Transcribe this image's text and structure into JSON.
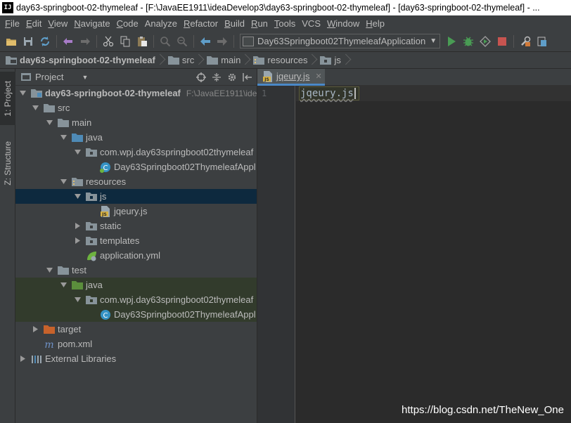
{
  "window": {
    "title": "day63-springboot-02-thymeleaf - [F:\\JavaEE1911\\ideaDevelop3\\day63-springboot-02-thymeleaf] - [day63-springboot-02-thymeleaf] - ...",
    "app_icon": "IJ"
  },
  "menu": {
    "items": [
      {
        "u": "F",
        "rest": "ile"
      },
      {
        "u": "E",
        "rest": "dit"
      },
      {
        "u": "V",
        "rest": "iew"
      },
      {
        "u": "N",
        "rest": "avigate"
      },
      {
        "u": "C",
        "rest": "ode"
      },
      {
        "u": "",
        "rest": "Analyze"
      },
      {
        "u": "R",
        "rest": "efactor"
      },
      {
        "u": "B",
        "rest": "uild"
      },
      {
        "u": "R",
        "rest": "un"
      },
      {
        "u": "T",
        "rest": "ools"
      },
      {
        "u": "",
        "rest": "VCS"
      },
      {
        "u": "W",
        "rest": "indow"
      },
      {
        "u": "H",
        "rest": "elp"
      }
    ]
  },
  "toolbar": {
    "run_config": "Day63Springboot02ThymeleafApplication",
    "icons": [
      "open-folder-icon",
      "save-icon",
      "sync-icon",
      "back-icon",
      "forward-icon",
      "cut-icon",
      "copy-icon",
      "paste-icon",
      "find-icon",
      "replace-icon",
      "nav-back-icon",
      "nav-forward-icon",
      "run-icon",
      "debug-icon",
      "coverage-icon",
      "stop-icon",
      "project-structure-icon",
      "sdk-icon"
    ]
  },
  "breadcrumb": {
    "items": [
      "day63-springboot-02-thymeleaf",
      "src",
      "main",
      "resources",
      "js"
    ]
  },
  "left_stripe": {
    "project_tab": "1: Project",
    "structure_tab": "Z: Structure"
  },
  "project_panel": {
    "title": "Project"
  },
  "tree": [
    {
      "label": "day63-springboot-02-thymeleaf",
      "path": "F:\\JavaEE1911\\ide",
      "bold": true
    },
    {
      "label": "src"
    },
    {
      "label": "main"
    },
    {
      "label": "java"
    },
    {
      "label": "com.wpj.day63springboot02thymeleaf"
    },
    {
      "label": "Day63Springboot02ThymeleafAppl"
    },
    {
      "label": "resources"
    },
    {
      "label": "js"
    },
    {
      "label": "jqeury.js"
    },
    {
      "label": "static"
    },
    {
      "label": "templates"
    },
    {
      "label": "application.yml"
    },
    {
      "label": "test"
    },
    {
      "label": "java"
    },
    {
      "label": "com.wpj.day63springboot02thymeleaf"
    },
    {
      "label": "Day63Springboot02ThymeleafAppl"
    },
    {
      "label": "target"
    },
    {
      "label": "pom.xml"
    },
    {
      "label": "External Libraries"
    }
  ],
  "editor": {
    "tab_label": "jqeury.js",
    "line_number": "1",
    "line_text": "jqeury.js"
  },
  "watermark": "https://blog.csdn.net/TheNew_One",
  "colors": {
    "bg": "#2b2b2b",
    "panel": "#3c3f41",
    "selection": "#0d293e",
    "test_bg": "#323b2c",
    "folder": "#87939a",
    "source_folder": "#4e8ab6",
    "test_folder": "#5b8e3c",
    "excluded_folder": "#c7622b",
    "run_green": "#499c54",
    "stop_red": "#c75450"
  }
}
